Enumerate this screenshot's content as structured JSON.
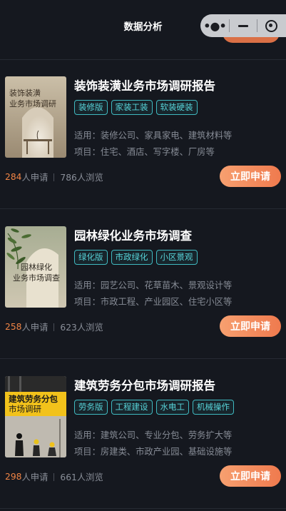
{
  "header": {
    "title": "数据分析",
    "capsule": {
      "more_icon": "more-dots-icon",
      "minimize_icon": "minimize-icon",
      "close_icon": "target-close-icon"
    }
  },
  "colors": {
    "accent": "#f07a4a",
    "tag": "#57d3d8",
    "count": "#f08445",
    "background": "#15181f"
  },
  "reports": [
    {
      "title": "装饰装潢业务市场调研报告",
      "cover_text": [
        "装饰装潢",
        "业务市场调研"
      ],
      "tags": [
        "装修版",
        "家装工装",
        "软装硬装"
      ],
      "industry": "适用：装修公司、家具家电、建筑材料等",
      "projects": "项目：住宅、酒店、写字楼、厂房等",
      "applicants": "284",
      "applicants_suffix": "人申请",
      "views": "786人浏览",
      "button": "立即申请"
    },
    {
      "title": "园林绿化业务市场调查",
      "cover_text": [
        "园林绿化",
        "业务市场调查"
      ],
      "tags": [
        "绿化版",
        "市政绿化",
        "小区景观"
      ],
      "industry": "适用：园艺公司、花草苗木、景观设计等",
      "projects": "项目：市政工程、产业园区、住宅小区等",
      "applicants": "258",
      "applicants_suffix": "人申请",
      "views": "623人浏览",
      "button": "立即申请"
    },
    {
      "title": "建筑劳务分包市场调研报告",
      "cover_text": [
        "建筑劳务分包",
        "市场调研"
      ],
      "tags": [
        "劳务版",
        "工程建设",
        "水电工",
        "机械操作"
      ],
      "industry": "适用：建筑公司、专业分包、劳务扩大等",
      "projects": "项目：房建类、市政产业园、基础设施等",
      "applicants": "298",
      "applicants_suffix": "人申请",
      "views": "661人浏览",
      "button": "立即申请"
    }
  ]
}
